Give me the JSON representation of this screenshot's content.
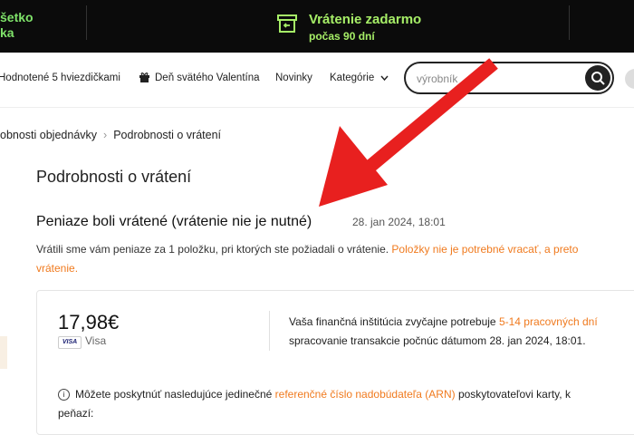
{
  "topbar": {
    "left_line1": "šetko",
    "left_line2": "ka",
    "promo_title": "Vrátenie zadarmo",
    "promo_subtitle": "počas 90 dní",
    "promo_icon": "return-box-icon",
    "colors": {
      "background": "#0b0b0b",
      "accent": "#a6ee67"
    }
  },
  "nav": {
    "items": [
      {
        "label": "Hodnotené 5 hviezdičkami"
      },
      {
        "label": "Deň svätého Valentína",
        "icon": "gift-icon"
      },
      {
        "label": "Novinky"
      },
      {
        "label": "Kategórie",
        "icon": "chevron-down-icon"
      }
    ],
    "search": {
      "placeholder": "výrobník",
      "icon": "search-icon"
    }
  },
  "breadcrumb": {
    "items": [
      "obnosti objednávky",
      "Podrobnosti o vrátení"
    ]
  },
  "page": {
    "title": "Podrobnosti o vrátení",
    "status_title": "Peniaze boli vrátené (vrátenie nie je nutné)",
    "status_date": "28. jan 2024, 18:01",
    "message_text": "Vrátili sme vám peniaze za 1 položku, pri ktorých ste požiadali o vrátenie.",
    "message_link": "Položky nie je potrebné vracať, a preto",
    "message_link_cont": "vrátenie.",
    "accent_color": "#f07a1e"
  },
  "card": {
    "amount": "17,98€",
    "card_brand_badge": "VISA",
    "card_brand": "Visa",
    "info_text_1": "Vaša finančná inštitúcia zvyčajne potrebuje",
    "info_link": "5-14 pracovných dní",
    "info_text_2": "spracovanie transakcie počnúc dátumom 28. jan 2024, 18:01.",
    "note_text_1": "Môžete poskytnúť nasledujúce jedinečné",
    "note_link": "referenčné číslo nadobúdateľa (ARN)",
    "note_text_2": "poskytovateľovi karty, k",
    "note_text_3": "peňazí:"
  },
  "annotation": {
    "color": "#e8201f",
    "icon": "red-arrow-icon"
  }
}
